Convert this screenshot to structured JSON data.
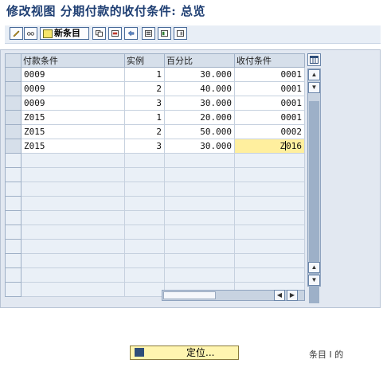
{
  "window": {
    "title": "修改视图 分期付款的收付条件: 总览"
  },
  "toolbar": {
    "new_entries_label": "新条目",
    "icons": [
      "change-display-icon",
      "copy-icon",
      "delete-icon",
      "undo-icon",
      "select-all-icon",
      "select-block-icon",
      "deselect-all-icon"
    ]
  },
  "table": {
    "columns": [
      "付款条件",
      "实例",
      "百分比",
      "收付条件"
    ],
    "rows": [
      {
        "key": "0009",
        "inst": "1",
        "pct": "30.000",
        "cond": "0001"
      },
      {
        "key": "0009",
        "inst": "2",
        "pct": "40.000",
        "cond": "0001"
      },
      {
        "key": "0009",
        "inst": "3",
        "pct": "30.000",
        "cond": "0001"
      },
      {
        "key": "Z015",
        "inst": "1",
        "pct": "20.000",
        "cond": "0001"
      },
      {
        "key": "Z015",
        "inst": "2",
        "pct": "50.000",
        "cond": "0002"
      },
      {
        "key": "Z015",
        "inst": "3",
        "pct": "30.000",
        "cond_a": "Z",
        "cond_b": "016"
      }
    ]
  },
  "buttons": {
    "position_label": "定位..."
  },
  "footer": {
    "watermark": "条目 I 的"
  },
  "colors": {
    "title": "#1f3f73",
    "header_bg": "#d6dfea",
    "highlight": "#ffef9e",
    "panel": "#e2e8f1"
  }
}
